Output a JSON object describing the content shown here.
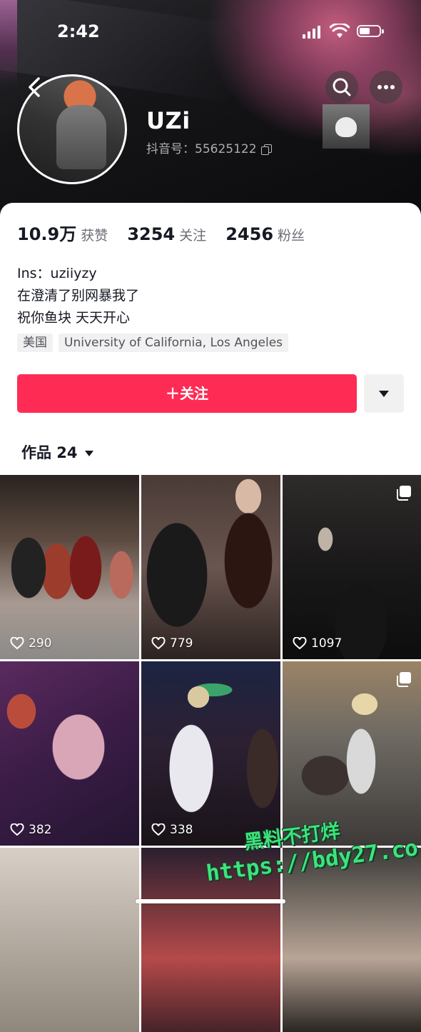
{
  "status_bar": {
    "time": "2:42"
  },
  "profile": {
    "username": "UZi",
    "douyin_id": "抖音号：55625122"
  },
  "stats": [
    {
      "value": "10.9万",
      "label": "获赞"
    },
    {
      "value": "3254",
      "label": "关注"
    },
    {
      "value": "2456",
      "label": "粉丝"
    }
  ],
  "bio": [
    "Ins：uziiyzy",
    "在澄清了别网暴我了",
    "祝你鱼块 天天开心"
  ],
  "tags": [
    "美国",
    "University of California, Los Angeles"
  ],
  "actions": {
    "follow_label": "＋关注"
  },
  "works": {
    "label": "作品 24"
  },
  "videos": [
    {
      "likes": "290",
      "multi": false
    },
    {
      "likes": "779",
      "multi": false
    },
    {
      "likes": "1097",
      "multi": true
    },
    {
      "likes": "382",
      "multi": false
    },
    {
      "likes": "338",
      "multi": false
    },
    {
      "likes": "",
      "multi": true
    },
    {
      "likes": "",
      "multi": false
    },
    {
      "likes": "",
      "multi": false
    },
    {
      "likes": "",
      "multi": false
    }
  ],
  "watermark": {
    "line1": "黑料不打烊",
    "line2": "https://bdy27.co"
  },
  "colors": {
    "accent": "#fe2c55",
    "text": "#161823",
    "muted": "#6b6d75"
  },
  "icons": [
    "back-icon",
    "search-icon",
    "more-icon",
    "copy-icon",
    "chevron-down-icon",
    "heart-icon",
    "multi-image-icon"
  ]
}
